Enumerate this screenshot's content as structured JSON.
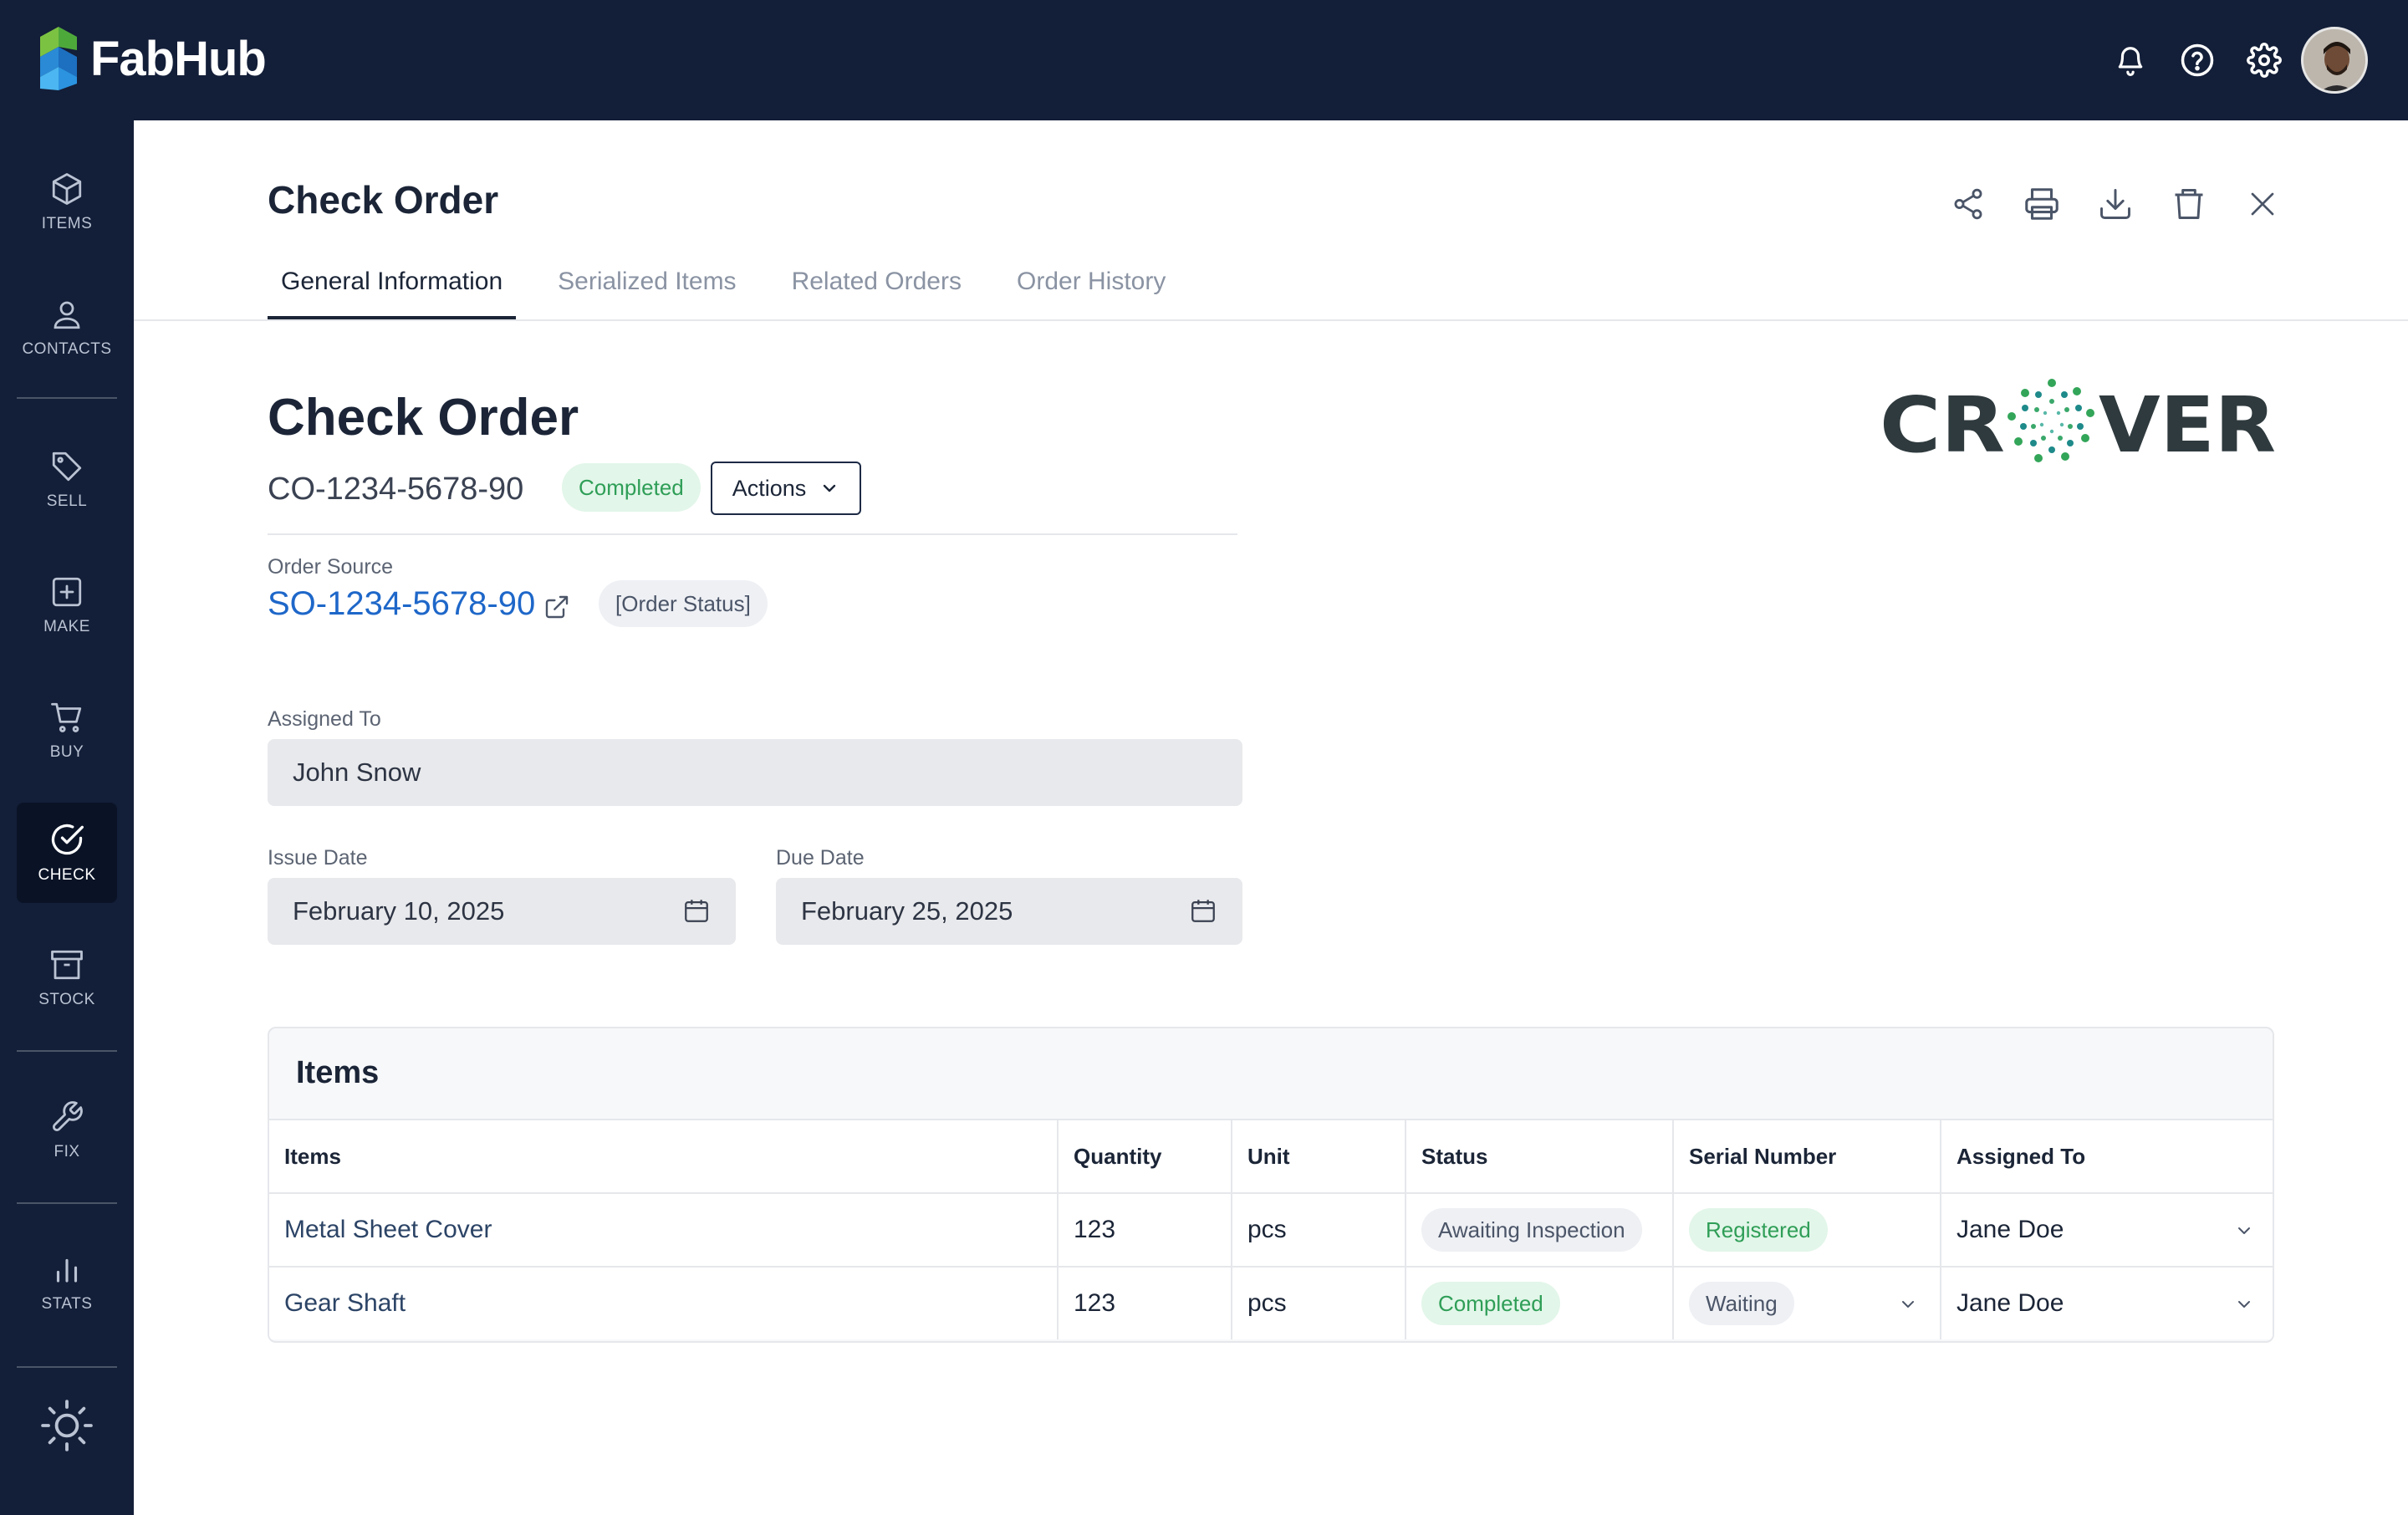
{
  "app": {
    "name": "FabHub"
  },
  "topbar": {
    "icons": [
      "bell-icon",
      "help-icon",
      "gear-icon"
    ],
    "avatar": "user-avatar"
  },
  "sidebar": {
    "items": [
      {
        "label": "ITEMS",
        "icon": "cube-icon"
      },
      {
        "label": "CONTACTS",
        "icon": "person-icon"
      },
      {
        "label": "SELL",
        "icon": "tag-icon"
      },
      {
        "label": "MAKE",
        "icon": "plus-square-icon"
      },
      {
        "label": "BUY",
        "icon": "cart-icon"
      },
      {
        "label": "CHECK",
        "icon": "check-circle-icon",
        "active": true
      },
      {
        "label": "STOCK",
        "icon": "archive-icon"
      },
      {
        "label": "FIX",
        "icon": "wrench-icon"
      },
      {
        "label": "STATS",
        "icon": "bar-chart-icon"
      }
    ],
    "theme_icon": "sun-icon"
  },
  "header": {
    "title": "Check Order",
    "actions": [
      "share-icon",
      "print-icon",
      "download-icon",
      "trash-icon",
      "close-icon"
    ]
  },
  "tabs": [
    {
      "label": "General Information",
      "active": true
    },
    {
      "label": "Serialized Items"
    },
    {
      "label": "Related Orders"
    },
    {
      "label": "Order History"
    }
  ],
  "order": {
    "title": "Check Order",
    "id": "CO-1234-5678-90",
    "status": "Completed",
    "actions_label": "Actions",
    "source_label": "Order Source",
    "source_id": "SO-1234-5678-90",
    "source_status": "[Order Status]",
    "assigned_label": "Assigned To",
    "assigned_value": "John Snow",
    "issue_label": "Issue Date",
    "issue_value": "February 10, 2025",
    "due_label": "Due Date",
    "due_value": "February 25, 2025"
  },
  "customer_logo": {
    "text": "CROVER",
    "colors": {
      "dark": "#2f3a3e",
      "green": "#33a559",
      "teal": "#1f8a8a"
    }
  },
  "items_table": {
    "title": "Items",
    "columns": [
      "Items",
      "Quantity",
      "Unit",
      "Status",
      "Serial Number",
      "Assigned To"
    ],
    "rows": [
      {
        "item": "Metal Sheet Cover",
        "quantity": "123",
        "unit": "pcs",
        "status": "Awaiting Inspection",
        "serial": "Registered",
        "assigned": "Jane Doe"
      },
      {
        "item": "Gear Shaft",
        "quantity": "123",
        "unit": "pcs",
        "status": "Completed",
        "serial": "Waiting",
        "assigned": "Jane Doe"
      }
    ]
  },
  "colors": {
    "navy": "#131e38",
    "link": "#1e67c9",
    "success_bg": "#e2f6e9",
    "success_fg": "#2f9e57"
  }
}
